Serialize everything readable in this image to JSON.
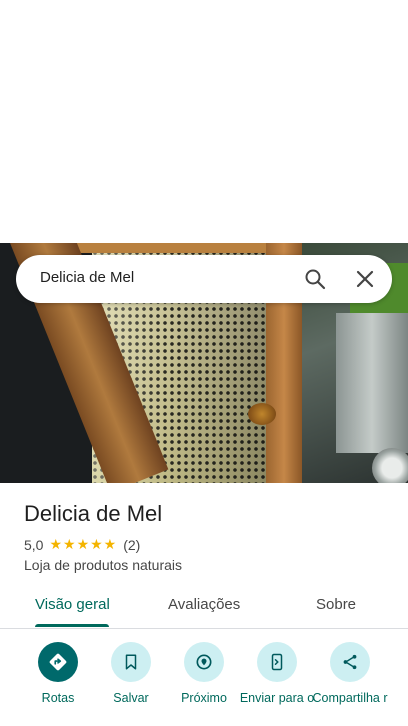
{
  "search": {
    "query": "Delicia de Mel"
  },
  "place": {
    "name": "Delicia de Mel",
    "rating": "5,0",
    "stars": "★★★★★",
    "review_count": "(2)",
    "category": "Loja de produtos naturais"
  },
  "tabs": [
    {
      "label": "Visão geral"
    },
    {
      "label": "Avaliações"
    },
    {
      "label": "Sobre"
    }
  ],
  "actions": [
    {
      "label": "Rotas",
      "icon": "directions-icon"
    },
    {
      "label": "Salvar",
      "icon": "bookmark-icon"
    },
    {
      "label": "Próximo",
      "icon": "nearby-icon"
    },
    {
      "label": "Enviar para o",
      "icon": "send-to-phone-icon"
    },
    {
      "label": "Compartilha r",
      "icon": "share-icon"
    }
  ],
  "colors": {
    "accent": "#00695c",
    "action_bg": "#cdeff2",
    "primary_action": "#00696b",
    "star": "#f4b400"
  }
}
